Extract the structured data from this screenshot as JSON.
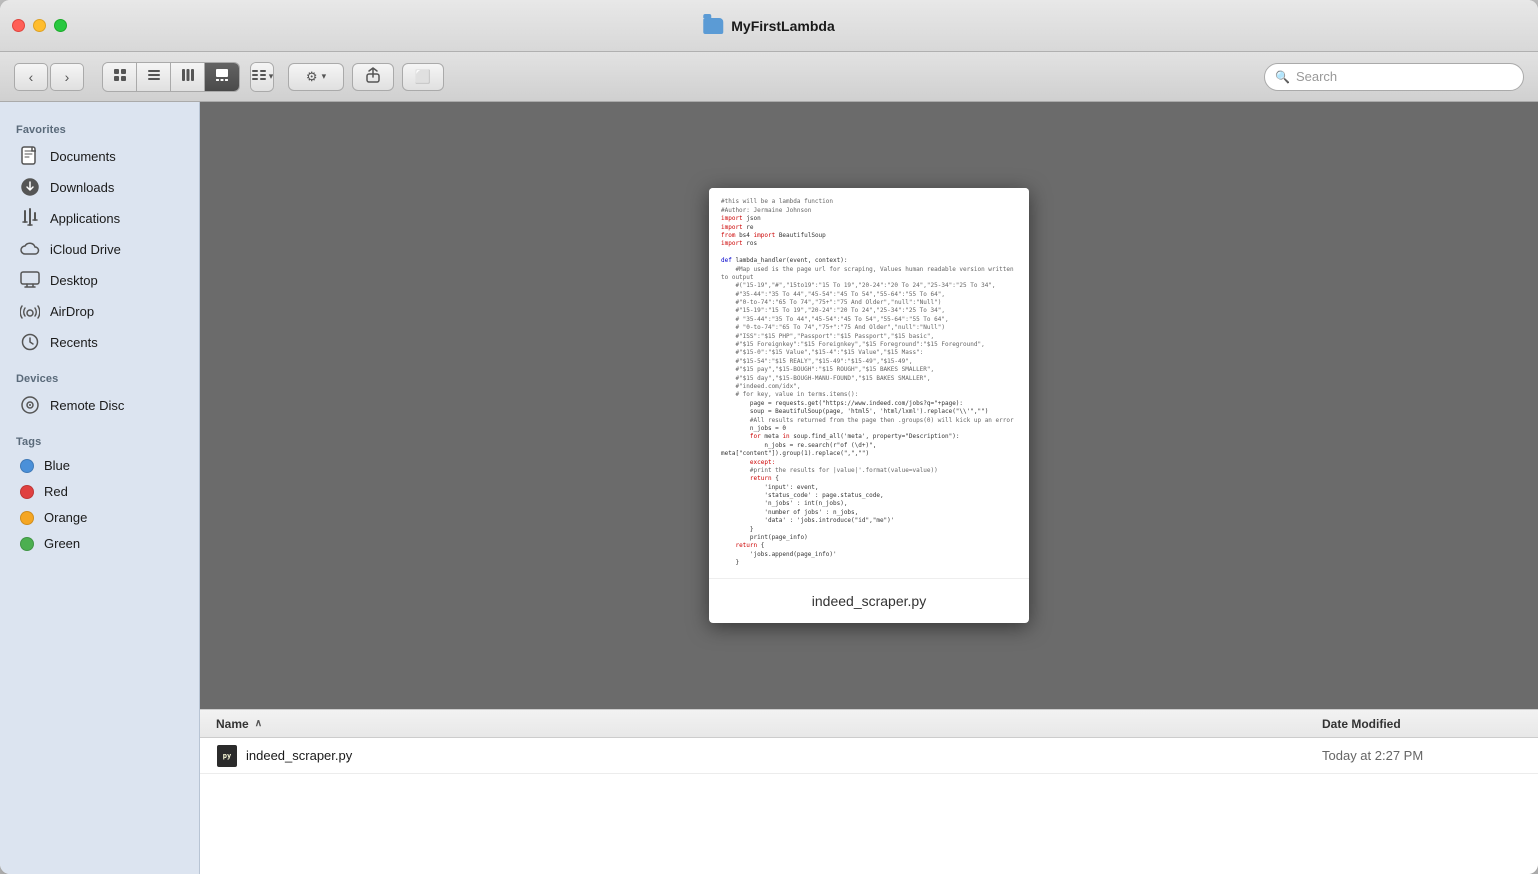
{
  "window": {
    "title": "MyFirstLambda",
    "controls": {
      "close": "close",
      "minimize": "minimize",
      "maximize": "maximize"
    }
  },
  "toolbar": {
    "back_label": "‹",
    "forward_label": "›",
    "view_icon": "⊞",
    "view_list": "☰",
    "view_column": "⊟",
    "view_gallery": "⊡",
    "view_group": "⊞",
    "settings_label": "⚙",
    "share_label": "↑",
    "tag_label": "⬜",
    "search_placeholder": "Search",
    "search_icon": "🔍"
  },
  "sidebar": {
    "sections": [
      {
        "header": "Favorites",
        "items": [
          {
            "id": "documents",
            "icon": "📄",
            "label": "Documents"
          },
          {
            "id": "downloads",
            "icon": "⬇",
            "label": "Downloads"
          },
          {
            "id": "applications",
            "icon": "📐",
            "label": "Applications"
          },
          {
            "id": "icloud",
            "icon": "☁",
            "label": "iCloud Drive"
          },
          {
            "id": "desktop",
            "icon": "🖥",
            "label": "Desktop"
          },
          {
            "id": "airdrop",
            "icon": "📡",
            "label": "AirDrop"
          },
          {
            "id": "recents",
            "icon": "🕐",
            "label": "Recents"
          }
        ]
      },
      {
        "header": "Devices",
        "items": [
          {
            "id": "remote-disc",
            "icon": "💿",
            "label": "Remote Disc"
          }
        ]
      },
      {
        "header": "Tags",
        "items": [
          {
            "id": "tag-blue",
            "color": "#4a90d9",
            "label": "Blue"
          },
          {
            "id": "tag-red",
            "color": "#e04040",
            "label": "Red"
          },
          {
            "id": "tag-orange",
            "color": "#f5a623",
            "label": "Orange"
          },
          {
            "id": "tag-green",
            "color": "#4caf50",
            "label": "Green"
          }
        ]
      }
    ]
  },
  "preview": {
    "filename": "indeed_scraper.py",
    "code_lines": [
      "#this will be a lambda function",
      "#Author: Jermaine Johnson",
      "import json",
      "import re",
      "from bs4 import BeautifulSoup",
      "import ros",
      "",
      "def lambda_handler(event, context):",
      "    #Map used is the page url for scraping. Values human readable version written to output",
      "    #(\"15-19\", \"#\",\"15to19\": \"15 To 19\", \"20-24\": \"20 To 24\", \"25-34\": \"25 To 34\",",
      "    #\"35-44\": \"35 To 44\", \"45-54\": \"45 To 54\", \"55-64\": \"55 To 64\",",
      "    #\"0-to-74\": \"65 To 74\", \"75+\": \"75 And Older\", \"null\": \"Null\")",
      "    #\"15-19\": \"15 To 19\", \"20-24\": \"20 To 24\", \"25-34\": \"25 To 34\",",
      "    # \"35-44\": \"35 To 44\", \"45-54\": \"45 To 54\", \"55-64\": \"55 To 64\",",
      "    # \"0-to-74\": \"65 To 74\", \"75+\": \"75 And Older\", \"null\": \"Null\")",
      "    #\"ISS\": \"$15 PHP\", \"Passport\": \"$15 Passport\", \"$15 basic\",",
      "    #\"$15 Foreignkey\": \"$15 Foreignkey\", \"$15 Foreground\": \"$15 Foreground\",",
      "    #\"$15-0\": \"$15 Value\", \"$15-4\": \"$15 Value\", \"$15 Mass\":",
      "    #\"$15-54\": \"$15 REALY\", \"$15-49\": \"$15-49\", \"$15-49\",",
      "    #\"$15 pay\", \"$15-BOUGH\": \"$15 ROUGH\", \"$15 BAKES SMALLER\",",
      "    #\"$15 day\", \"$15-BOUGH-MANU-FOUND\", \"$15 BAKES SMALLER\",",
      "    #\"indeed.com/idx\",",
      "    # for key, value in terms.items():",
      "        page = requests.get(\"https://www.indeed.com/jobs?q=\"+page):",
      "        soup = BeautifulSoup(page, 'html5', 'html/lxml').replace(\"\\'\",\"\")",
      "        #All results returned from the page then .groups(0) will kick up an error",
      "        n_jobs = 0",
      "        for meta in soup.find_all('meta', property=\"Description\"):",
      "            n_jobs = re.search(r\"of (\\d+)\", meta[\"content\"]).group(1).replace(\",\",\"\")",
      "        except:",
      "        #print the results for |value|'.format(value=value))",
      "        return {",
      "            'input': event,",
      "            'status_code' : page.status_code,",
      "            'n_jobs' : int(n_jobs),",
      "            'number of jobs' : n_jobs,",
      "            'data' : 'jobs.introduce(\"id\",\"me\")'",
      "        }",
      "        print(page_info)",
      "    return {",
      "        'jobs.append(page_info)'",
      "    }"
    ]
  },
  "file_list": {
    "columns": [
      {
        "id": "name",
        "label": "Name",
        "sortable": true,
        "sort_direction": "asc"
      },
      {
        "id": "date_modified",
        "label": "Date Modified",
        "sortable": false
      }
    ],
    "files": [
      {
        "id": "indeed_scraper",
        "name": "indeed_scraper.py",
        "date_modified": "Today at 2:27 PM",
        "type": "python"
      }
    ]
  }
}
